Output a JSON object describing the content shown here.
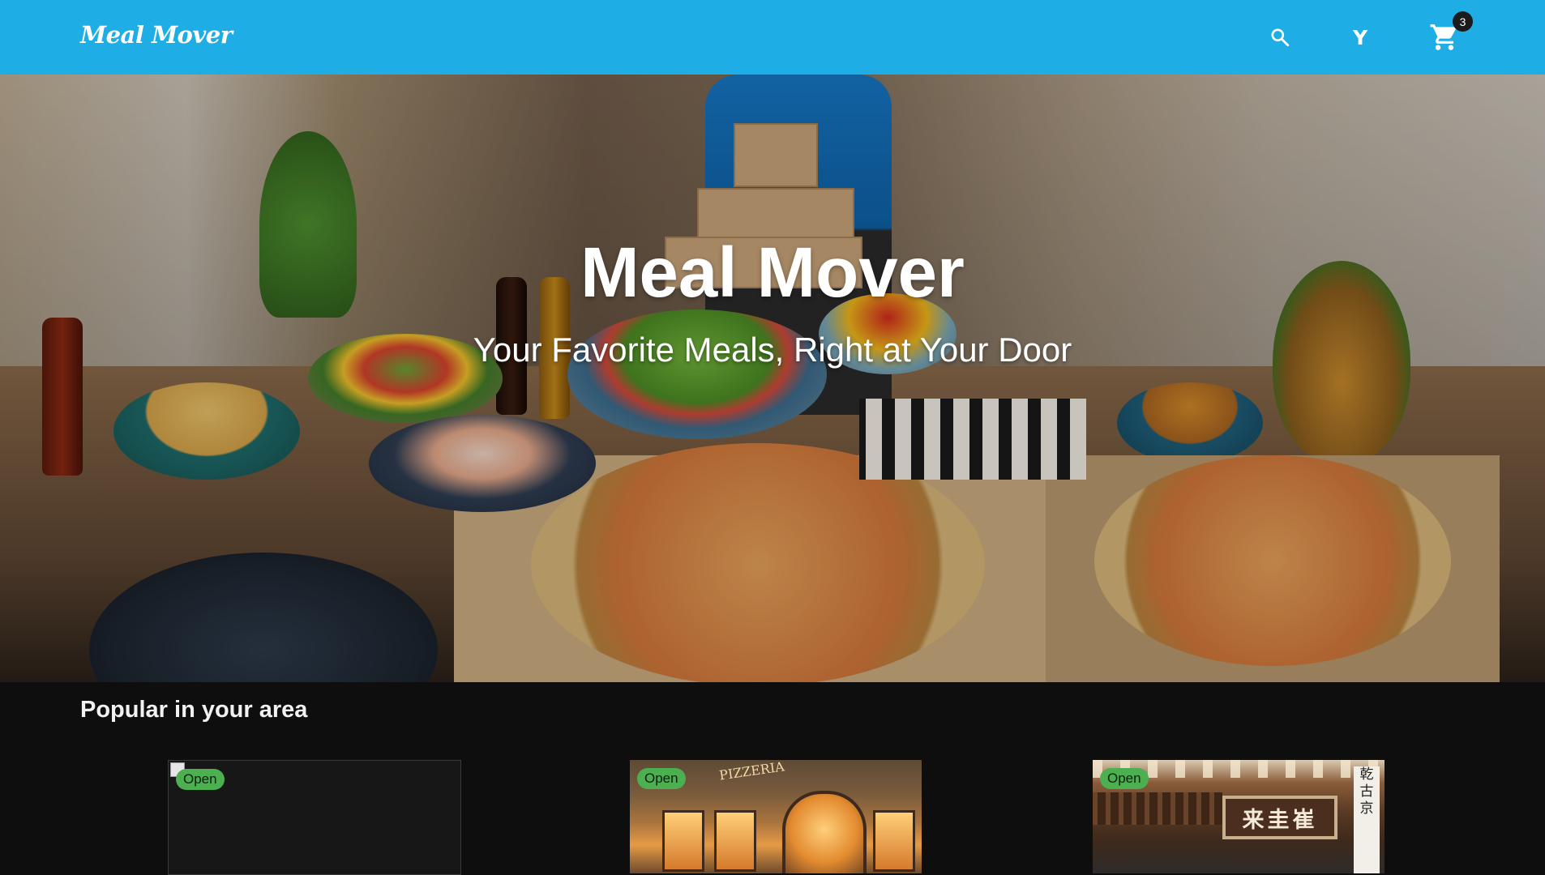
{
  "header": {
    "logo": "Meal Mover",
    "search_icon": "search-icon",
    "avatar_letter": "Y",
    "cart_icon": "shopping-cart-icon",
    "cart_count": "3",
    "bar_color": "#1fade6"
  },
  "hero": {
    "title": "Meal Mover",
    "subtitle": "Your Favorite Meals, Right at Your Door"
  },
  "popular": {
    "heading": "Popular in your area",
    "restaurants": [
      {
        "status": "Open",
        "image": "broken"
      },
      {
        "status": "Open",
        "sign_text": "PIZZERIA"
      },
      {
        "status": "Open",
        "board_text": "来圭崔",
        "vertical_sign": "乾古京"
      }
    ]
  },
  "colors": {
    "open_badge": "#4caf50",
    "page_background": "#0e0e0e"
  }
}
